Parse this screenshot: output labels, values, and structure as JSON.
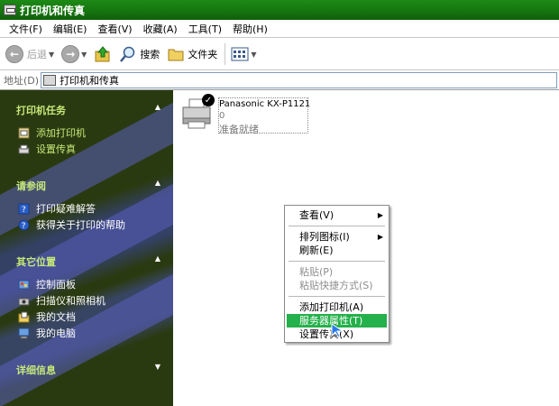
{
  "window": {
    "title": "打印机和传真"
  },
  "menubar": {
    "items": [
      {
        "label": "文件(F)"
      },
      {
        "label": "编辑(E)"
      },
      {
        "label": "查看(V)"
      },
      {
        "label": "收藏(A)"
      },
      {
        "label": "工具(T)"
      },
      {
        "label": "帮助(H)"
      }
    ]
  },
  "toolbar": {
    "back_label": "后退",
    "search_label": "搜索",
    "folders_label": "文件夹"
  },
  "address": {
    "label": "地址(D)",
    "value": "打印机和传真"
  },
  "taskpane": {
    "printer_tasks": {
      "title": "打印机任务",
      "items": [
        {
          "label": "添加打印机"
        },
        {
          "label": "设置传真"
        }
      ]
    },
    "see_also": {
      "title": "请参阅",
      "items": [
        {
          "label": "打印疑难解答"
        },
        {
          "label": "获得关于打印的帮助"
        }
      ]
    },
    "other_places": {
      "title": "其它位置",
      "items": [
        {
          "label": "控制面板"
        },
        {
          "label": "扫描仪和照相机"
        },
        {
          "label": "我的文档"
        },
        {
          "label": "我的电脑"
        }
      ]
    },
    "details": {
      "title": "详细信息"
    }
  },
  "printer": {
    "name": "Panasonic KX-P1121",
    "count": "0",
    "status": "准备就绪"
  },
  "context_menu": {
    "items": [
      {
        "label": "查看(V)"
      },
      {
        "label": "排列图标(I)"
      },
      {
        "label": "刷新(E)"
      },
      {
        "label": "粘贴(P)"
      },
      {
        "label": "粘贴快捷方式(S)"
      },
      {
        "label": "添加打印机(A)"
      },
      {
        "label": "服务器属性(T)"
      },
      {
        "label": "设置传真(X)"
      }
    ]
  },
  "colors": {
    "title_bar": "#16750f",
    "taskpane_bg": "#2a3a10",
    "taskpane_header": "#c6e87a",
    "highlight": "#24b04a"
  }
}
